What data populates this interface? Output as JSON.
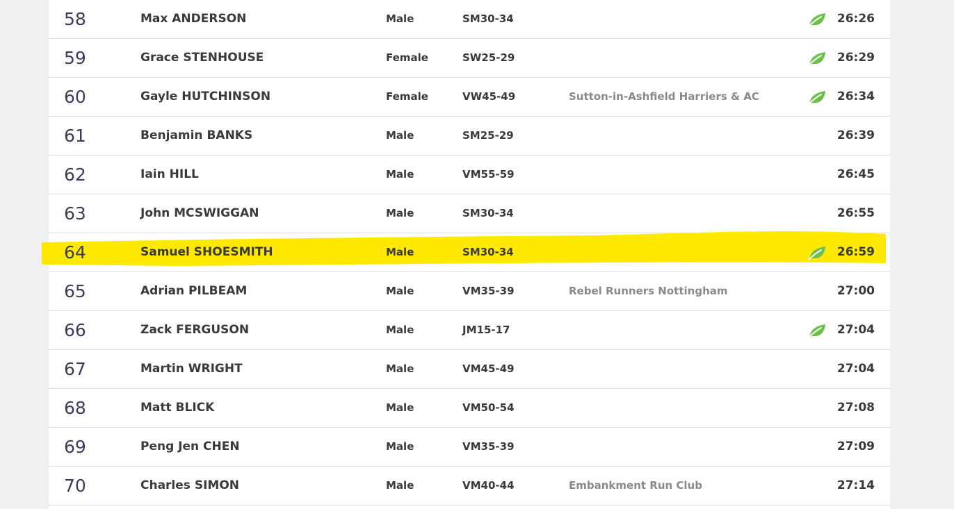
{
  "colors": {
    "highlight": "#ffe900",
    "leaf": "#6cc04a",
    "club_text": "#8a8a8a",
    "position_text": "#3c3c5e"
  },
  "results": [
    {
      "position": "58",
      "name": "Max ANDERSON",
      "gender": "Male",
      "category": "SM30-34",
      "club": "",
      "time": "26:26",
      "leaf": true,
      "highlighted": false
    },
    {
      "position": "59",
      "name": "Grace STENHOUSE",
      "gender": "Female",
      "category": "SW25-29",
      "club": "",
      "time": "26:29",
      "leaf": true,
      "highlighted": false
    },
    {
      "position": "60",
      "name": "Gayle HUTCHINSON",
      "gender": "Female",
      "category": "VW45-49",
      "club": "Sutton-in-Ashfield Harriers & AC",
      "time": "26:34",
      "leaf": true,
      "highlighted": false
    },
    {
      "position": "61",
      "name": "Benjamin BANKS",
      "gender": "Male",
      "category": "SM25-29",
      "club": "",
      "time": "26:39",
      "leaf": false,
      "highlighted": false
    },
    {
      "position": "62",
      "name": "Iain HILL",
      "gender": "Male",
      "category": "VM55-59",
      "club": "",
      "time": "26:45",
      "leaf": false,
      "highlighted": false
    },
    {
      "position": "63",
      "name": "John MCSWIGGAN",
      "gender": "Male",
      "category": "SM30-34",
      "club": "",
      "time": "26:55",
      "leaf": false,
      "highlighted": false
    },
    {
      "position": "64",
      "name": "Samuel SHOESMITH",
      "gender": "Male",
      "category": "SM30-34",
      "club": "",
      "time": "26:59",
      "leaf": true,
      "highlighted": true
    },
    {
      "position": "65",
      "name": "Adrian PILBEAM",
      "gender": "Male",
      "category": "VM35-39",
      "club": "Rebel Runners Nottingham",
      "time": "27:00",
      "leaf": false,
      "highlighted": false
    },
    {
      "position": "66",
      "name": "Zack FERGUSON",
      "gender": "Male",
      "category": "JM15-17",
      "club": "",
      "time": "27:04",
      "leaf": true,
      "highlighted": false
    },
    {
      "position": "67",
      "name": "Martin WRIGHT",
      "gender": "Male",
      "category": "VM45-49",
      "club": "",
      "time": "27:04",
      "leaf": false,
      "highlighted": false
    },
    {
      "position": "68",
      "name": "Matt BLICK",
      "gender": "Male",
      "category": "VM50-54",
      "club": "",
      "time": "27:08",
      "leaf": false,
      "highlighted": false
    },
    {
      "position": "69",
      "name": "Peng Jen CHEN",
      "gender": "Male",
      "category": "VM35-39",
      "club": "",
      "time": "27:09",
      "leaf": false,
      "highlighted": false
    },
    {
      "position": "70",
      "name": "Charles SIMON",
      "gender": "Male",
      "category": "VM40-44",
      "club": "Embankment Run Club",
      "time": "27:14",
      "leaf": false,
      "highlighted": false
    }
  ]
}
